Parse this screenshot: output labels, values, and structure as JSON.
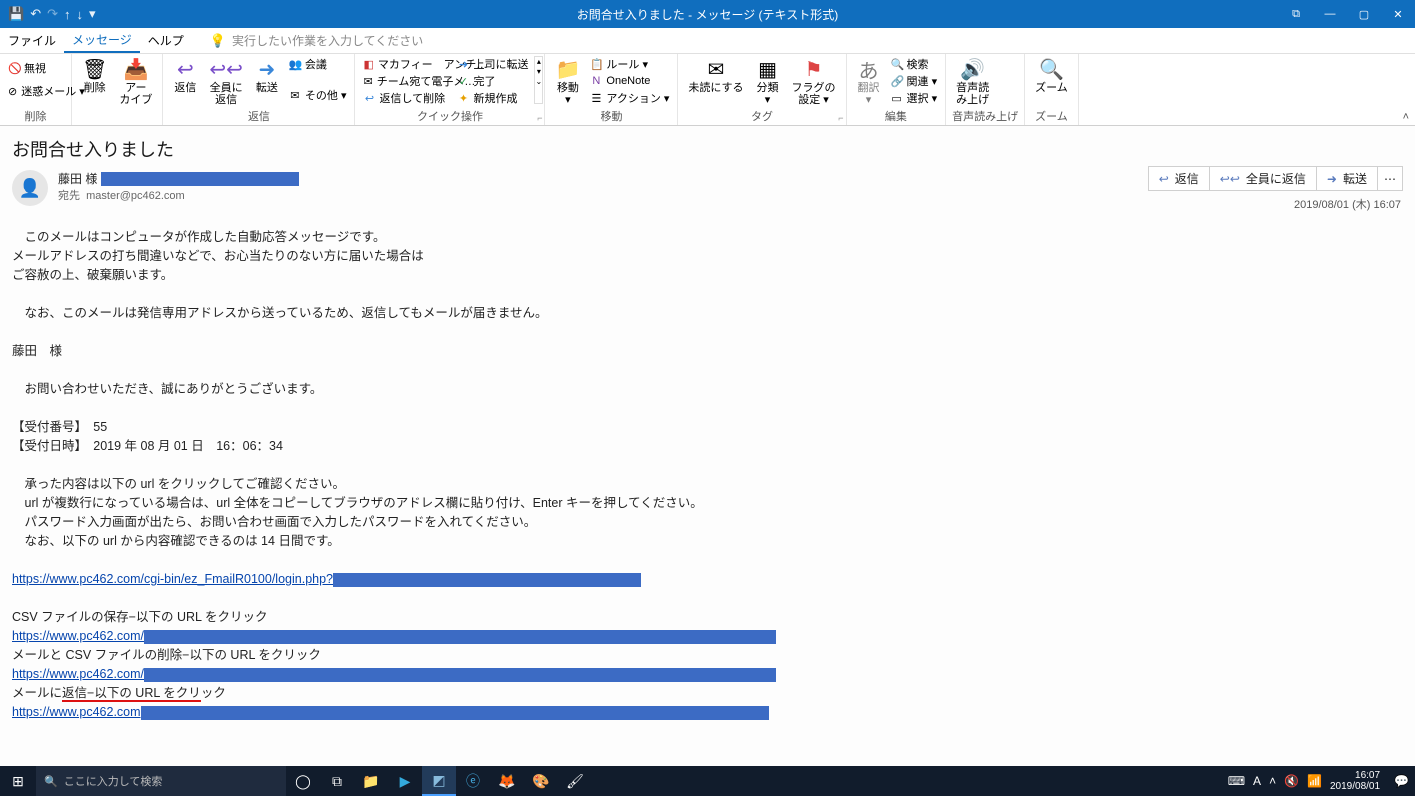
{
  "titlebar": {
    "title": "お問合せ入りました  -  メッセージ (テキスト形式)",
    "qa_save": "💾",
    "qa_undo": "↶",
    "qa_redo": "↷",
    "qa_up": "↑",
    "qa_down": "↓",
    "qa_more": "▾"
  },
  "menubar": {
    "file": "ファイル",
    "message": "メッセージ",
    "help": "ヘルプ",
    "tellme": "実行したい作業を入力してください"
  },
  "ribbon": {
    "g1": {
      "ignore": "無視",
      "junk": "迷惑メール ▾",
      "label": "削除"
    },
    "delete": {
      "del": "削除",
      "arch": "アー\nカイブ"
    },
    "respond": {
      "reply": "返信",
      "replyall": "全員に\n返信",
      "fwd": "転送",
      "meeting": "会議",
      "more": "その他 ▾",
      "label": "返信"
    },
    "quick": {
      "a": "マカフィー　アンチ…",
      "b": "チーム宛て電子メ…",
      "c": "返信して削除",
      "d": "上司に転送",
      "e": "完了",
      "f": "新規作成",
      "label": "クイック操作"
    },
    "move": {
      "move": "移動\n▾",
      "onenote": "OneNote",
      "rules": "ルール ▾",
      "actions": "アクション ▾",
      "label": "移動"
    },
    "tags": {
      "unread": "未読にする",
      "cat": "分類\n▾",
      "flag": "フラグの\n設定 ▾",
      "label": "タグ"
    },
    "edit": {
      "trans": "翻訳\n▾",
      "find": "検索",
      "rel": "関連 ▾",
      "sel": "選択 ▾",
      "label": "編集"
    },
    "speech": {
      "s": "音声読\nみ上げ",
      "label": "音声読み上げ"
    },
    "zoom": {
      "z": "ズーム",
      "label": "ズーム"
    }
  },
  "mail": {
    "subject": "お問合せ入りました",
    "from": "藤田 様",
    "to_label": "宛先",
    "to": "master@pc462.com",
    "actions": {
      "reply": "返信",
      "replyall": "全員に返信",
      "fwd": "転送"
    },
    "timestamp": "2019/08/01 (木) 16:07"
  },
  "body": {
    "l1": "　このメールはコンピュータが作成した自動応答メッセージです。",
    "l2": "メールアドレスの打ち間違いなどで、お心当たりのない方に届いた場合は",
    "l3": "ご容赦の上、破棄願います。",
    "l4": "　なお、このメールは発信専用アドレスから送っているため、返信してもメールが届きません。",
    "l5": "藤田　様",
    "l6": "　お問い合わせいただき、誠にありがとうございます。",
    "l7": "【受付番号】　55",
    "l8": "【受付日時】　2019 年 08 月 01 日　16：06：34",
    "l9": "　承った内容は以下の url をクリックしてご確認ください。",
    "l10": "　url が複数行になっている場合は、url 全体をコピーしてブラウザのアドレス欄に貼り付け、Enter キーを押してください。",
    "l11": "　パスワード入力画面が出たら、お問い合わせ画面で入力したパスワードを入れてください。",
    "l12": "　なお、以下の url から内容確認できるのは 14 日間です。",
    "link1": "https://www.pc462.com/cgi-bin/ez_FmailR0100/login.php?",
    "l13": "CSV ファイルの保存−以下の URL をクリック",
    "link2": "https://www.pc462.com/",
    "l14": "メールと CSV ファイルの削除−以下の URL をクリック",
    "link3": "https://www.pc462.com/",
    "l15": "メールに返信−以下の URL をクリック",
    "link4": "https://www.pc462.com"
  },
  "taskbar": {
    "search": "ここに入力して検索",
    "time": "16:07",
    "date": "2019/08/01"
  }
}
